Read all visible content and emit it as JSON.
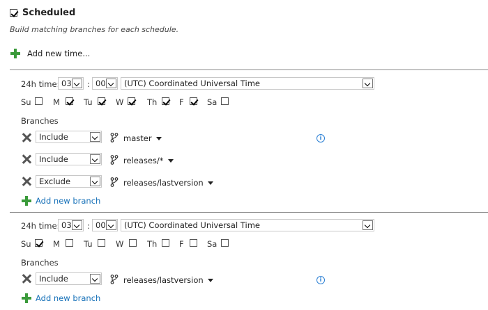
{
  "trigger": {
    "checked": true,
    "title": "Scheduled",
    "subtitle": "Build matching branches for each schedule.",
    "add_time_label": "Add new time..."
  },
  "labels": {
    "time_label": "24h time:",
    "colon": ":",
    "branches": "Branches",
    "add_branch": "Add new branch",
    "info_glyph": "i"
  },
  "schedules": [
    {
      "hour": "03",
      "minute": "00",
      "timezone": "(UTC) Coordinated Universal Time",
      "days": [
        {
          "label": "Su",
          "checked": false
        },
        {
          "label": "M",
          "checked": true
        },
        {
          "label": "Tu",
          "checked": true
        },
        {
          "label": "W",
          "checked": true
        },
        {
          "label": "Th",
          "checked": true
        },
        {
          "label": "F",
          "checked": true
        },
        {
          "label": "Sa",
          "checked": false
        }
      ],
      "branches": [
        {
          "mode": "Include",
          "branch": "master"
        },
        {
          "mode": "Include",
          "branch": "releases/*"
        },
        {
          "mode": "Exclude",
          "branch": "releases/lastversion"
        }
      ]
    },
    {
      "hour": "03",
      "minute": "00",
      "timezone": "(UTC) Coordinated Universal Time",
      "days": [
        {
          "label": "Su",
          "checked": true
        },
        {
          "label": "M",
          "checked": false
        },
        {
          "label": "Tu",
          "checked": false
        },
        {
          "label": "W",
          "checked": false
        },
        {
          "label": "Th",
          "checked": false
        },
        {
          "label": "F",
          "checked": false
        },
        {
          "label": "Sa",
          "checked": false
        }
      ],
      "branches": [
        {
          "mode": "Include",
          "branch": "releases/lastversion"
        }
      ]
    }
  ]
}
